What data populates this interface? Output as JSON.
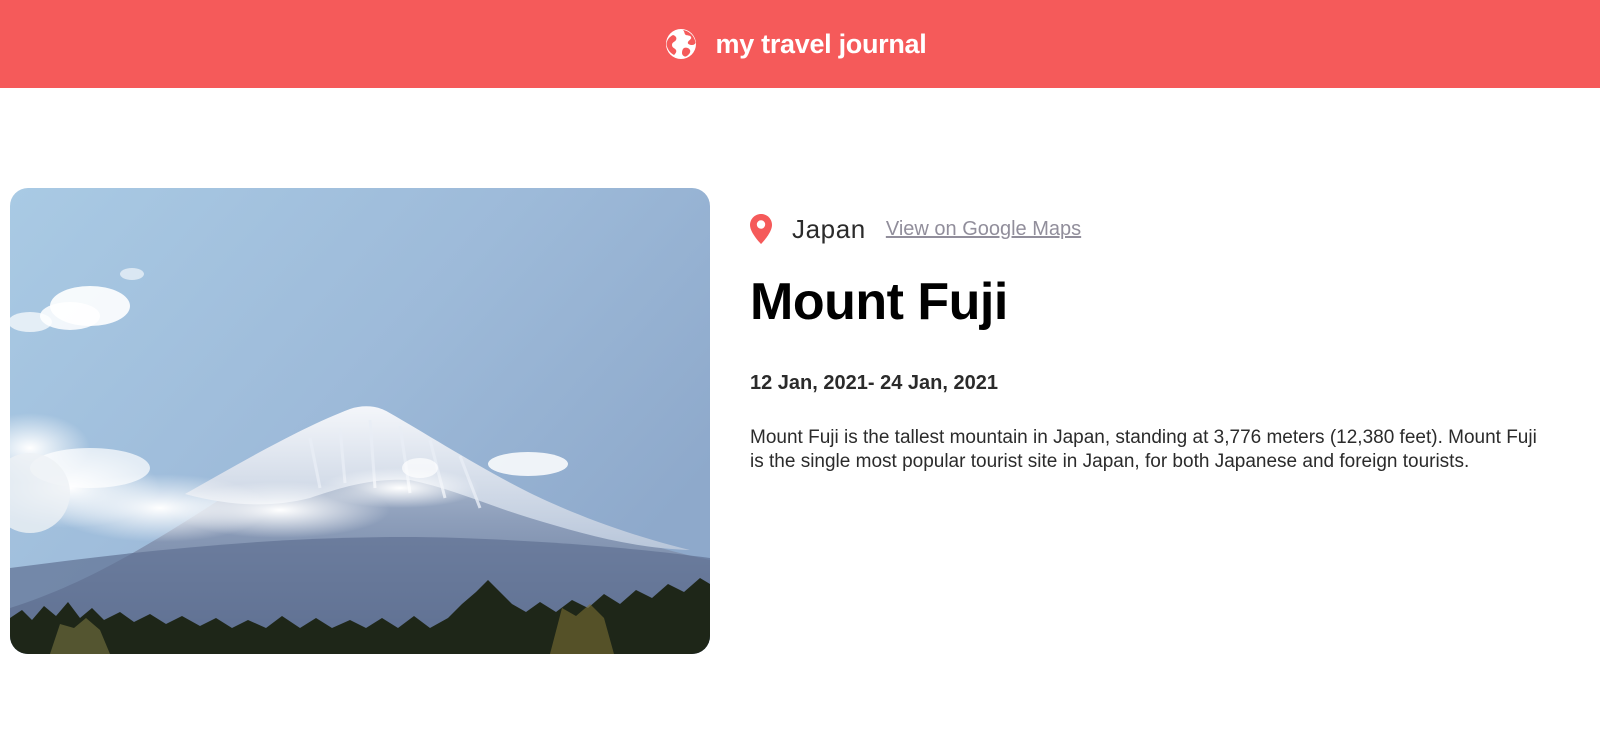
{
  "header": {
    "title": "my travel journal",
    "icon": "globe-icon",
    "background": "#F55A5A"
  },
  "entry": {
    "location": "Japan",
    "location_icon": "map-pin-icon",
    "maps_link_label": "View on Google Maps",
    "title": "Mount Fuji",
    "dates": "12 Jan, 2021- 24 Jan, 2021",
    "description": "Mount Fuji is the tallest mountain in Japan, standing at 3,776 meters (12,380 feet). Mount Fuji is the single most popular tourist site in Japan, for both Japanese and foreign tourists.",
    "accent_color": "#F55A5A",
    "link_color": "#918E9B"
  }
}
